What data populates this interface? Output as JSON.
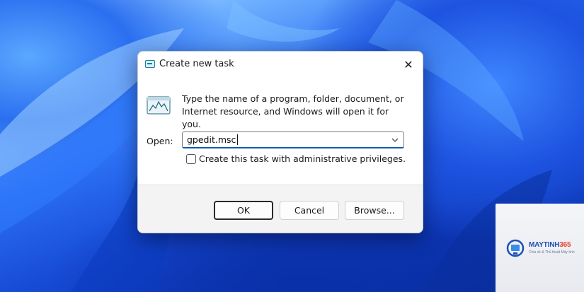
{
  "dialog": {
    "title": "Create new task",
    "close_glyph": "✕",
    "description_line1": "Type the name of a program, folder, document, or",
    "description_line2": "Internet resource, and Windows will open it for you.",
    "open_label": "Open:",
    "open_value": "gpedit.msc",
    "admin_checkbox_label": "Create this task with administrative privileges.",
    "admin_checked": false,
    "buttons": {
      "ok": "OK",
      "cancel": "Cancel",
      "browse": "Browse..."
    }
  },
  "watermark": {
    "brand": "MAYTINH",
    "brand_number": "365",
    "tagline": "Chia sẻ & Thủ thuật Máy tính"
  },
  "icons": {
    "title": "run-window-icon",
    "run": "run-program-icon",
    "close": "close-icon",
    "dropdown": "chevron-down-icon"
  },
  "colors": {
    "accent_underline": "#0b5cad",
    "wallpaper": "#1a4fd0"
  }
}
